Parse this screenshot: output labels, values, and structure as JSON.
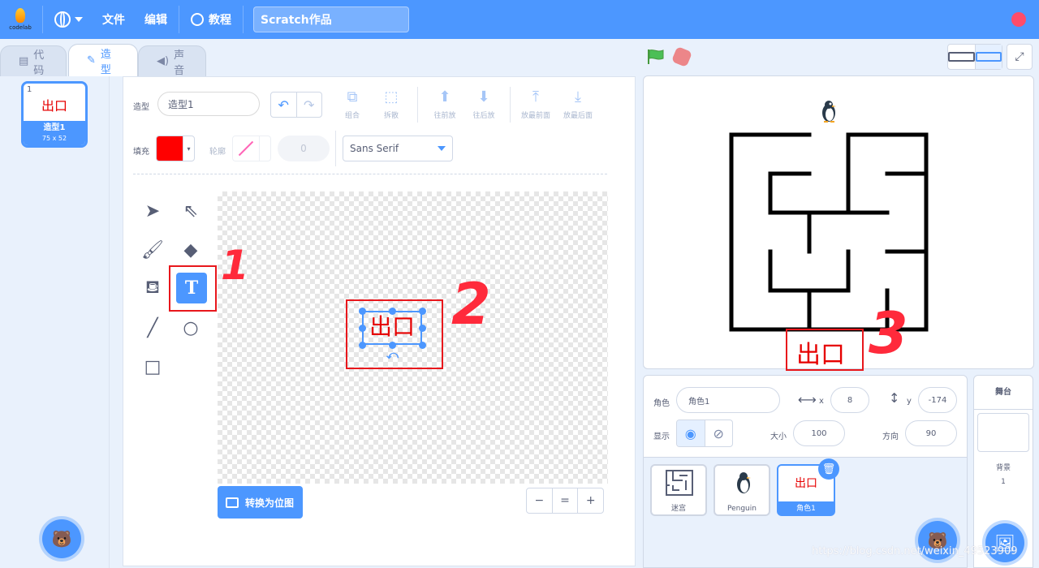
{
  "menubar": {
    "logo_text": "codelab",
    "file": "文件",
    "edit": "编辑",
    "tutorial": "教程",
    "project_title": "Scratch作品"
  },
  "tabs": {
    "code": "代码",
    "costumes": "造型",
    "sounds": "声音"
  },
  "costume_list": {
    "items": [
      {
        "num": "1",
        "art_text": "出口",
        "name": "造型1",
        "size": "75 x 52"
      }
    ]
  },
  "editor": {
    "costume_label": "造型",
    "costume_name": "造型1",
    "toolbar": {
      "group": "组合",
      "ungroup": "拆散",
      "forward": "往前放",
      "backward": "往后放",
      "front": "放最前面",
      "back": "放最后面"
    },
    "fill_label": "填充",
    "fill_color": "#ff0000",
    "outline_label": "轮廓",
    "outline_width": "0",
    "font": "Sans Serif",
    "canvas_text": "出口",
    "convert_button": "转换为位图",
    "zoom": {
      "out": "−",
      "reset": "=",
      "in": "+"
    }
  },
  "annotations": [
    "1",
    "2",
    "3"
  ],
  "stage": {
    "text": "出口"
  },
  "sprite_info": {
    "sprite_label": "角色",
    "sprite_name": "角色1",
    "x_label": "x",
    "x": "8",
    "y_label": "y",
    "y": "-174",
    "show_label": "显示",
    "size_label": "大小",
    "size": "100",
    "direction_label": "方向",
    "direction": "90"
  },
  "sprites": [
    {
      "name": "迷宫"
    },
    {
      "name": "Penguin"
    },
    {
      "name": "角色1",
      "art_text": "出口"
    }
  ],
  "stage_selector": {
    "title": "舞台",
    "backdrops_label": "背景",
    "backdrops_count": "1"
  },
  "watermark": "https://blog.csdn.net/weixin_49523909"
}
